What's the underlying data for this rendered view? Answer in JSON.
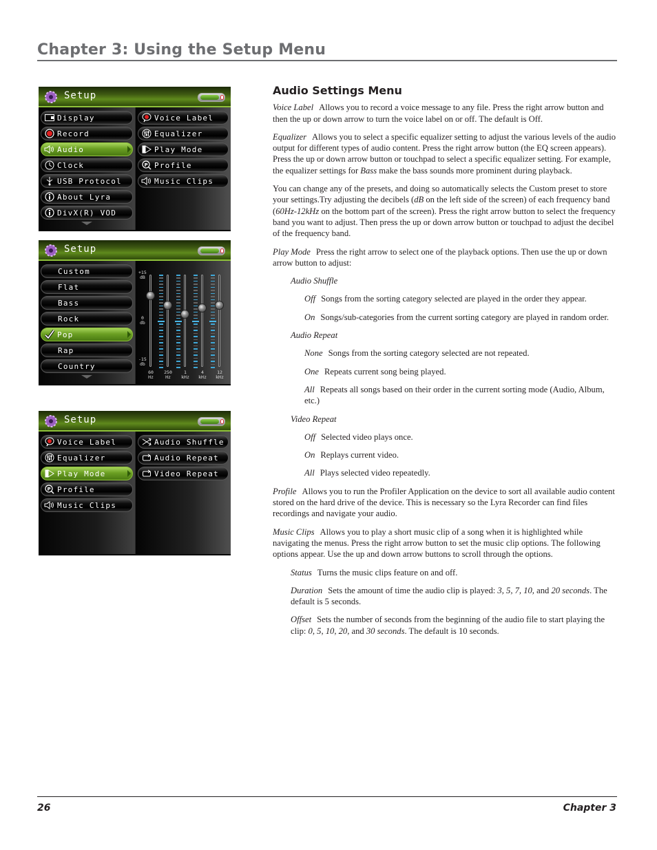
{
  "page": {
    "chapter_title": "Chapter 3: Using the Setup Menu",
    "footer": {
      "page_number": "26",
      "chapter": "Chapter 3"
    }
  },
  "colors": {
    "accent_green": "#6b9f23",
    "eq_blue": "#3fa8d8",
    "title_gray": "#6d6e71"
  },
  "screens": [
    {
      "title": "Setup",
      "left_items": [
        {
          "label": "Display",
          "icon": "display-icon",
          "selected": false
        },
        {
          "label": "Record",
          "icon": "record-icon",
          "selected": false
        },
        {
          "label": "Audio",
          "icon": "speaker-icon",
          "selected": true
        },
        {
          "label": "Clock",
          "icon": "clock-icon",
          "selected": false
        },
        {
          "label": "USB Protocol",
          "icon": "usb-icon",
          "selected": false
        },
        {
          "label": "About Lyra",
          "icon": "info-icon",
          "selected": false
        },
        {
          "label": "DivX(R) VOD",
          "icon": "info-icon",
          "selected": false
        }
      ],
      "right_items": [
        {
          "label": "Voice Label",
          "icon": "voice-label-icon"
        },
        {
          "label": "Equalizer",
          "icon": "equalizer-icon"
        },
        {
          "label": "Play Mode",
          "icon": "play-mode-icon"
        },
        {
          "label": "Profile",
          "icon": "profile-icon"
        },
        {
          "label": "Music Clips",
          "icon": "speaker-icon"
        }
      ]
    },
    {
      "title": "Setup",
      "presets": [
        {
          "label": "Custom",
          "selected": false
        },
        {
          "label": "Flat",
          "selected": false
        },
        {
          "label": "Bass",
          "selected": false
        },
        {
          "label": "Rock",
          "selected": false
        },
        {
          "label": "Pop",
          "selected": true
        },
        {
          "label": "Rap",
          "selected": false
        },
        {
          "label": "Country",
          "selected": false
        }
      ],
      "eq": {
        "db_top": "+15",
        "db_top_unit": "dB",
        "db_mid": "0",
        "db_mid_unit": "db",
        "db_bottom": "-15",
        "db_bottom_unit": "db",
        "range_db": [
          -15,
          15
        ],
        "bands": [
          {
            "freq": "60",
            "unit": "Hz",
            "value_db": 8
          },
          {
            "freq": "250",
            "unit": "Hz",
            "value_db": 5
          },
          {
            "freq": "1",
            "unit": "kHz",
            "value_db": 2
          },
          {
            "freq": "4",
            "unit": "kHz",
            "value_db": 4
          },
          {
            "freq": "12",
            "unit": "kHz",
            "value_db": 5
          }
        ]
      }
    },
    {
      "title": "Setup",
      "left_items": [
        {
          "label": "Voice Label",
          "icon": "voice-label-icon",
          "selected": false
        },
        {
          "label": "Equalizer",
          "icon": "equalizer-icon",
          "selected": false
        },
        {
          "label": "Play Mode",
          "icon": "play-mode-icon",
          "selected": true
        },
        {
          "label": "Profile",
          "icon": "profile-icon",
          "selected": false
        },
        {
          "label": "Music Clips",
          "icon": "speaker-icon",
          "selected": false
        }
      ],
      "right_items": [
        {
          "label": "Audio Shuffle",
          "icon": "shuffle-icon"
        },
        {
          "label": "Audio Repeat",
          "icon": "repeat-icon"
        },
        {
          "label": "Video Repeat",
          "icon": "repeat-icon"
        }
      ]
    }
  ],
  "content": {
    "section_title": "Audio Settings Menu",
    "voice_label": {
      "term": "Voice Label",
      "text": "Allows you to record a voice message to any file. Press the right arrow button and then the up or down arrow to turn the voice label on or off. The default is Off."
    },
    "equalizer": {
      "term": "Equalizer",
      "text_a": "Allows you to select a specific equalizer setting to adjust the various levels of the audio output for different types of audio content. Press the right arrow button (the EQ screen appears). Press the up or down arrow button or touchpad to select a specific equalizer setting. For example, the equalizer settings for ",
      "em": "Bass",
      "text_b": " make the bass sounds more prominent during playback."
    },
    "presets_para": {
      "text_a": "You can change any of the presets, and doing so automatically selects the Custom preset to store your settings.Try adjusting the decibels (",
      "em_a": "dB",
      "text_b": " on the left side of the screen) of each frequency band (",
      "em_b": "60Hz-12kHz",
      "text_c": " on the bottom part of the screen). Press the right arrow button to select the frequency band you want to adjust. Then press the up or down arrow button or touchpad to adjust the decibel of the frequency band."
    },
    "play_mode": {
      "term": "Play Mode",
      "text": "Press the right arrow to select one of the playback options. Then use the up or down arrow button to adjust:"
    },
    "audio_shuffle": {
      "heading": "Audio Shuffle",
      "options": [
        {
          "term": "Off",
          "text": "Songs from the sorting category selected are played in the order they appear."
        },
        {
          "term": "On",
          "text": "Songs/sub-categories from the current sorting category are played in random order."
        }
      ]
    },
    "audio_repeat": {
      "heading": "Audio Repeat",
      "options": [
        {
          "term": "None",
          "text": "Songs from the sorting category selected are not repeated."
        },
        {
          "term": "One",
          "text": "Repeats current song being played."
        },
        {
          "term": "All",
          "text": "Repeats all songs based on their order in the current sorting mode (Audio, Album, etc.)"
        }
      ]
    },
    "video_repeat": {
      "heading": "Video Repeat",
      "options": [
        {
          "term": "Off",
          "text": "Selected video plays once."
        },
        {
          "term": "On",
          "text": "Replays current video."
        },
        {
          "term": "All",
          "text": "Plays selected video repeatedly."
        }
      ]
    },
    "profile": {
      "term": "Profile",
      "text": "Allows you to run the Profiler Application on the device to sort all available audio content stored on the hard drive of the device. This is necessary so the Lyra Recorder can find files recordings and navigate your audio."
    },
    "music_clips": {
      "term": "Music Clips",
      "text": "Allows you to play a short music clip of a song when it is highlighted while navigating the menus. Press the right arrow button to set the music clip options. The following options appear. Use the up and down arrow buttons to scroll through the options."
    },
    "status": {
      "term": "Status",
      "text": "Turns the music clips feature on and off."
    },
    "duration": {
      "term": "Duration",
      "text_a": "Sets the amount of time the audio clip is played: ",
      "em_a": "3, 5, 7, 10,",
      "text_b": " and ",
      "em_b": "20 seconds",
      "text_c": ". The default is 5 seconds."
    },
    "offset": {
      "term": "Offset",
      "text_a": "Sets the number of seconds from the beginning of the audio file to start playing the clip: ",
      "em_a": "0, 5, 10, 20,",
      "text_b": " and ",
      "em_b": "30 seconds",
      "text_c": ". The default is 10 seconds."
    }
  }
}
